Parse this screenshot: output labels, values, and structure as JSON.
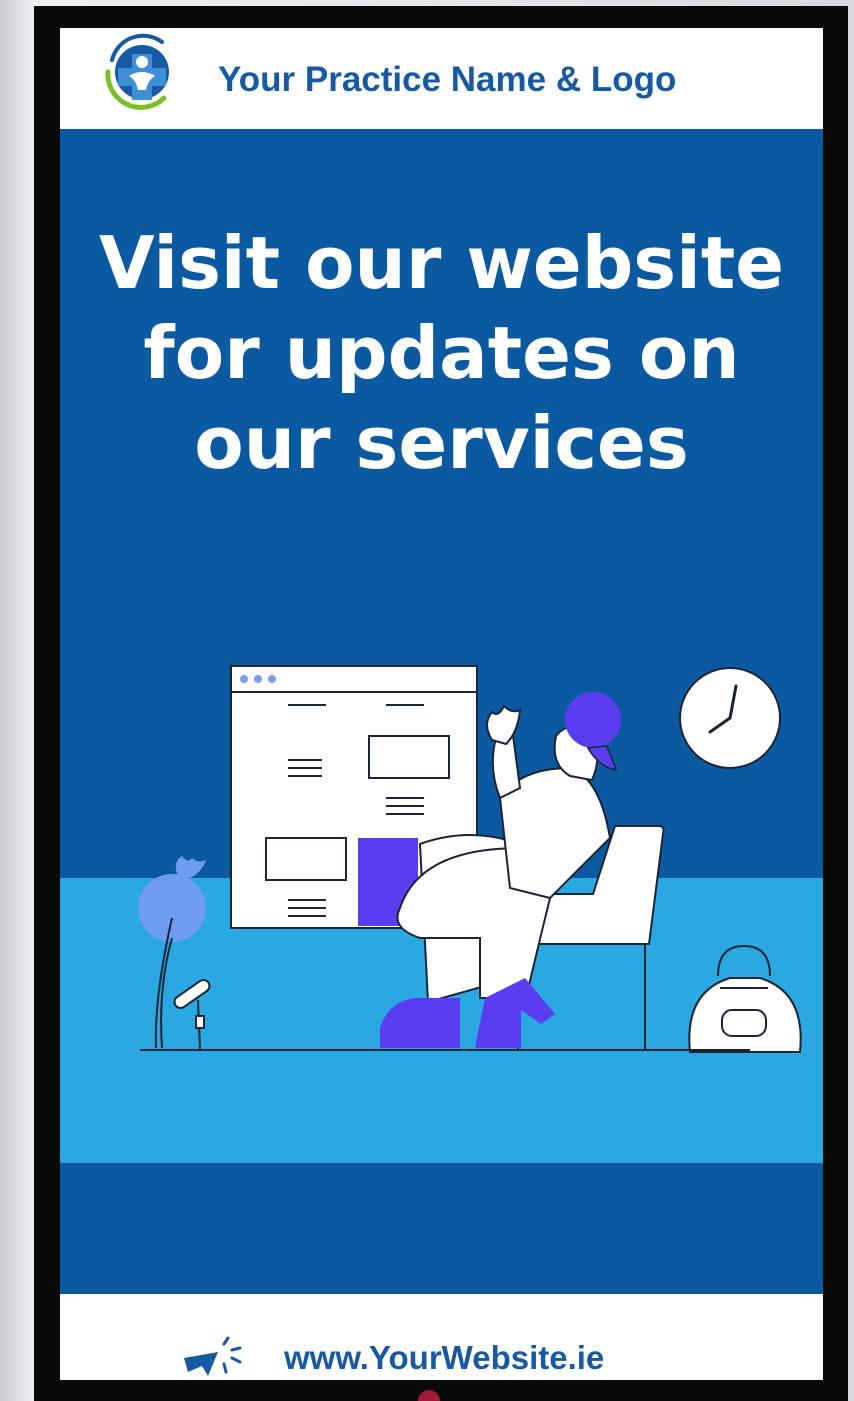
{
  "header": {
    "logo_icon": "medical-cross-person-icon",
    "practice_name": "Your Practice Name & Logo"
  },
  "main": {
    "headline_lines": [
      "Visit our website",
      "for updates on",
      "our services"
    ],
    "illustration": "person-at-website-illustration"
  },
  "footer": {
    "cursor_icon": "cursor-click-icon",
    "website": "www.YourWebsite.ie"
  },
  "colors": {
    "brand_blue": "#1859a4",
    "panel_blue": "#0b5aa1",
    "floor_blue": "#2aa8e2",
    "accent_purple": "#5a3df0",
    "logo_green": "#7bbf2a"
  }
}
